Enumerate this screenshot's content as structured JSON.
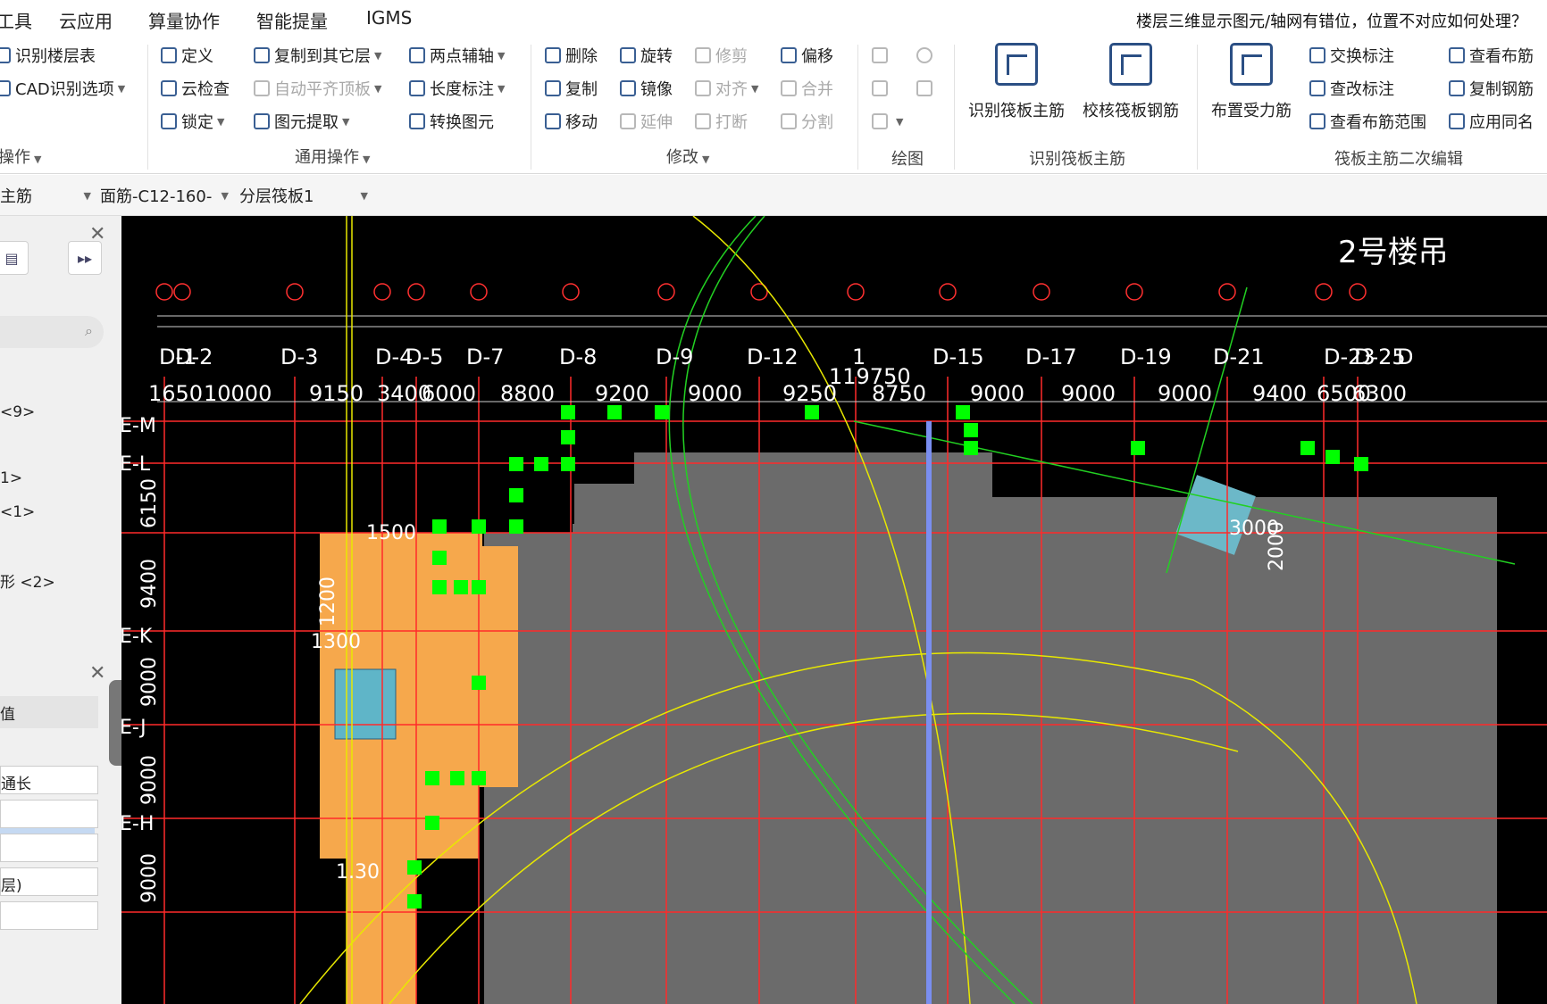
{
  "menu": {
    "items": [
      "工具",
      "云应用",
      "算量协作",
      "智能提量",
      "IGMS"
    ],
    "help_question": "楼层三维显示图元/轴网有错位，位置不对应如何处理？"
  },
  "ribbon": {
    "group1": {
      "items": [
        "识别楼层表",
        "CAD识别选项"
      ],
      "label": "操作"
    },
    "group2": {
      "items": [
        "定义",
        "云检查",
        "锁定",
        "复制到其它层",
        "自动平齐顶板",
        "图元提取",
        "两点辅轴",
        "长度标注",
        "转换图元"
      ],
      "label": "通用操作"
    },
    "group3": {
      "items": [
        "删除",
        "复制",
        "移动",
        "旋转",
        "镜像",
        "延伸",
        "修剪",
        "对齐",
        "打断",
        "偏移",
        "合并",
        "分割"
      ],
      "label": "修改"
    },
    "group4": {
      "label": "绘图"
    },
    "group5": {
      "big_buttons": [
        "识别筏板主筋",
        "校核筏板钢筋"
      ],
      "label": "识别筏板主筋"
    },
    "group6": {
      "big_button": "布置受力筋",
      "items": [
        "交换标注",
        "查改标注",
        "查看布筋范围",
        "查看布筋",
        "复制钢筋",
        "应用同名"
      ],
      "label": "筏板主筋二次编辑"
    }
  },
  "toolbar2": {
    "combo1": "主筋",
    "combo2": "面筋-C12-160-",
    "combo3": "分层筏板1"
  },
  "left_panel": {
    "items": [
      "<9>",
      "1>",
      "<1>",
      "形 <2>"
    ],
    "prop_header": "值",
    "prop_values": [
      "通长",
      "层)"
    ]
  },
  "cad": {
    "building_label": "2号楼吊",
    "axis_labels": [
      "D-1",
      "D-2",
      "D-3",
      "D-4",
      "D-5",
      "D-7",
      "D-8",
      "D-9",
      "D-12",
      "1",
      "D-15",
      "D-17",
      "D-19",
      "D-21",
      "D-23",
      "D-25",
      "D"
    ],
    "dimensions": [
      "1650",
      "10000",
      "9150",
      "3400",
      "6000",
      "8800",
      "9200",
      "9000",
      "9250",
      "8750",
      "9000",
      "9000",
      "9000",
      "9400",
      "6500",
      "6300"
    ],
    "total_dimension": "119750",
    "row_labels": [
      "E-M",
      "E-L",
      "E-K",
      "E-J",
      "E-H"
    ],
    "row_dims": [
      "6150",
      "9400",
      "9000",
      "9000",
      "9000"
    ],
    "misc_text": [
      "3000",
      "2000",
      "1500",
      "1300",
      "1200",
      "1.30"
    ],
    "colors": {
      "background": "#000000",
      "slab_gray": "#6b6b6b",
      "orange_slab": "#f6a84c",
      "axis_red": "#ff2a2a",
      "green_grip": "#00ff00",
      "yellow_line": "#e8e800",
      "green_line": "#22d022"
    }
  }
}
